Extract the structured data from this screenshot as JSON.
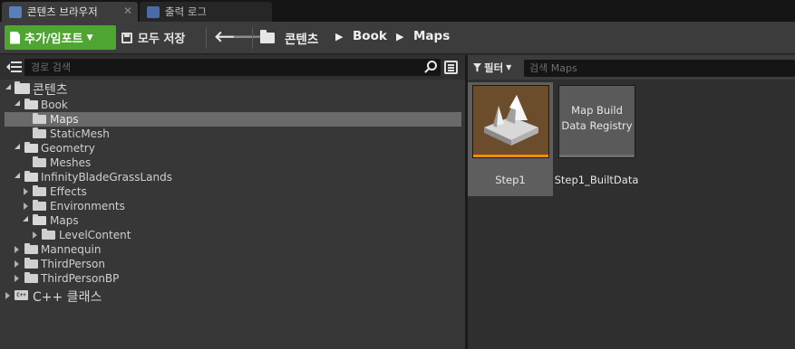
{
  "tabs": [
    {
      "label": "콘텐츠 브라우저",
      "icon": "content-browser-icon",
      "active": true
    },
    {
      "label": "출력 로그",
      "icon": "output-log-icon",
      "active": false
    }
  ],
  "toolbar": {
    "add_import_label": "추가/임포트",
    "save_all_label": "모두 저장",
    "breadcrumbs": [
      "콘텐츠",
      "Book",
      "Maps"
    ]
  },
  "left_panel": {
    "search_placeholder": "경로 검색",
    "tree": [
      {
        "label": "콘텐츠",
        "depth": 0,
        "expanded": true
      },
      {
        "label": "Book",
        "depth": 1,
        "expanded": true
      },
      {
        "label": "Maps",
        "depth": 2,
        "selected": true
      },
      {
        "label": "StaticMesh",
        "depth": 2
      },
      {
        "label": "Geometry",
        "depth": 1,
        "expanded": true
      },
      {
        "label": "Meshes",
        "depth": 2
      },
      {
        "label": "InfinityBladeGrassLands",
        "depth": 1,
        "expanded": true
      },
      {
        "label": "Effects",
        "depth": 2,
        "expanded": false
      },
      {
        "label": "Environments",
        "depth": 2,
        "expanded": false
      },
      {
        "label": "Maps",
        "depth": 2,
        "expanded": true
      },
      {
        "label": "LevelContent",
        "depth": 3,
        "expanded": false
      },
      {
        "label": "Mannequin",
        "depth": 1,
        "expanded": false
      },
      {
        "label": "ThirdPerson",
        "depth": 1,
        "expanded": false
      },
      {
        "label": "ThirdPersonBP",
        "depth": 1,
        "expanded": false
      },
      {
        "label": "C++ 클래스",
        "depth": 0,
        "expanded": false
      }
    ]
  },
  "right_panel": {
    "filter_label": "필터",
    "search_placeholder": "검색 Maps",
    "assets": [
      {
        "name": "Step1",
        "type": "level-map",
        "selected": true
      },
      {
        "name": "Step1_BuiltData",
        "thumb_text_line1": "Map Build",
        "thumb_text_line2": "Data Registry",
        "selected": false
      }
    ]
  },
  "colors": {
    "add_button": "#4fa532",
    "map_accent": "#f08c0a",
    "selection": "#6a6a6a"
  }
}
